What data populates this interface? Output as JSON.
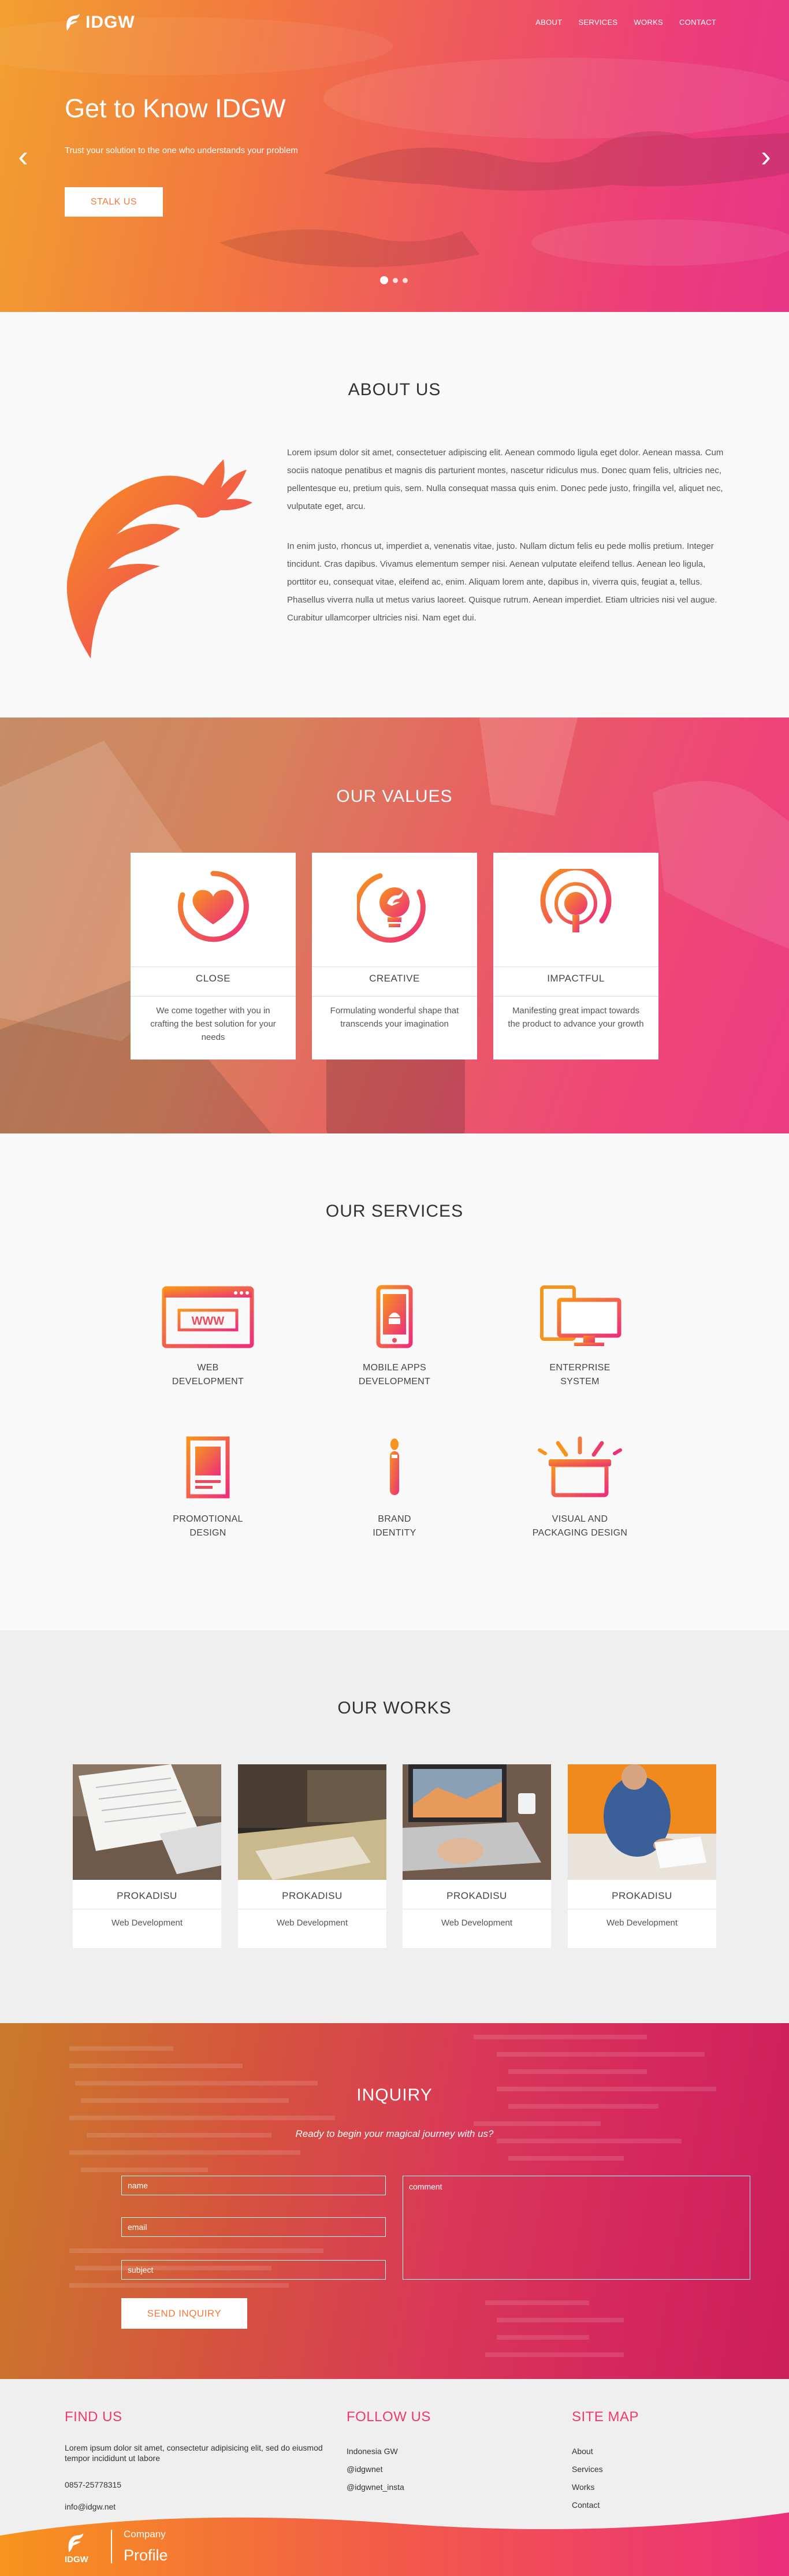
{
  "brand": {
    "name": "IDGW",
    "primary": "#f07a3a",
    "accent": "#ec3c82",
    "footer_heading": "#f0376e"
  },
  "nav": {
    "items": [
      "ABOUT",
      "SERVICES",
      "WORKS",
      "CONTACT"
    ]
  },
  "hero": {
    "title": "Get to Know IDGW",
    "tagline": "Trust your solution to the one who understands your problem",
    "cta": "STALK US",
    "prev_icon": "chevron-left-icon",
    "next_icon": "chevron-right-icon",
    "slides_total": 3,
    "slide_active": 1
  },
  "about": {
    "title": "ABOUT US",
    "paragraphs": [
      "Lorem ipsum dolor sit amet, consectetuer adipiscing elit. Aenean commodo ligula eget dolor. Aenean massa. Cum sociis natoque penatibus et magnis dis parturient montes, nascetur ridiculus mus. Donec quam felis, ultricies nec, pellentesque eu, pretium quis, sem. Nulla consequat massa quis enim. Donec pede justo, fringilla vel, aliquet nec, vulputate eget, arcu.",
      "In enim justo, rhoncus ut, imperdiet a, venenatis vitae, justo. Nullam dictum felis eu pede mollis pretium. Integer tincidunt. Cras dapibus. Vivamus elementum semper nisi. Aenean vulputate eleifend tellus. Aenean leo ligula, porttitor eu, consequat vitae, eleifend ac, enim. Aliquam lorem ante, dapibus in, viverra quis, feugiat a, tellus. Phasellus viverra nulla ut metus varius laoreet. Quisque rutrum. Aenean imperdiet. Etiam ultricies nisi vel augue. Curabitur ullamcorper ultricies nisi. Nam eget dui."
    ]
  },
  "values": {
    "title": "OUR VALUES",
    "items": [
      {
        "icon": "heart-circle-icon",
        "title": "CLOSE",
        "desc": "We come together with you in crafting the best solution for your needs"
      },
      {
        "icon": "lightbulb-logo-icon",
        "title": "CREATIVE",
        "desc": "Formulating wonderful shape that transcends your imagination"
      },
      {
        "icon": "target-bulb-icon",
        "title": "IMPACTFUL",
        "desc": "Manifesting great impact towards the product to advance your growth"
      }
    ]
  },
  "services": {
    "title": "OUR SERVICES",
    "items": [
      {
        "icon": "browser-www-icon",
        "label": "WEB\nDEVELOPMENT"
      },
      {
        "icon": "mobile-phone-icon",
        "label": "MOBILE APPS\nDEVELOPMENT"
      },
      {
        "icon": "monitor-tablet-icon",
        "label": "ENTERPRISE\nSYSTEM"
      },
      {
        "icon": "brochure-icon",
        "label": "PROMOTIONAL\nDESIGN"
      },
      {
        "icon": "pencil-brand-icon",
        "label": "BRAND\nIDENTITY"
      },
      {
        "icon": "package-box-icon",
        "label": "VISUAL AND\nPACKAGING DESIGN"
      }
    ]
  },
  "works": {
    "title": "OUR WORKS",
    "items": [
      {
        "title": "PROKADISU",
        "category": "Web Development"
      },
      {
        "title": "PROKADISU",
        "category": "Web Development"
      },
      {
        "title": "PROKADISU",
        "category": "Web Development"
      },
      {
        "title": "PROKADISU",
        "category": "Web Development"
      }
    ]
  },
  "inquiry": {
    "title": "INQUIRY",
    "subtitle": "Ready to begin your magical journey with us?",
    "name_placeholder": "name",
    "email_placeholder": "email",
    "subject_placeholder": "subject",
    "comment_placeholder": "comment",
    "submit": "SEND INQUIRY"
  },
  "footer": {
    "find": {
      "title": "FIND US",
      "address": "Lorem ipsum dolor sit amet, consectetur adipisicing elit, sed do eiusmod tempor incididunt ut labore",
      "phone": "0857-25778315",
      "email": "info@idgw.net"
    },
    "follow": {
      "title": "FOLLOW US",
      "items": [
        "Indonesia GW",
        "@idgwnet",
        "@idgwnet_insta"
      ]
    },
    "sitemap": {
      "title": "SITE MAP",
      "items": [
        "About",
        "Services",
        "Works",
        "Contact"
      ]
    },
    "logo_text": "IDGW",
    "company": "Company",
    "profile": "Profile"
  }
}
